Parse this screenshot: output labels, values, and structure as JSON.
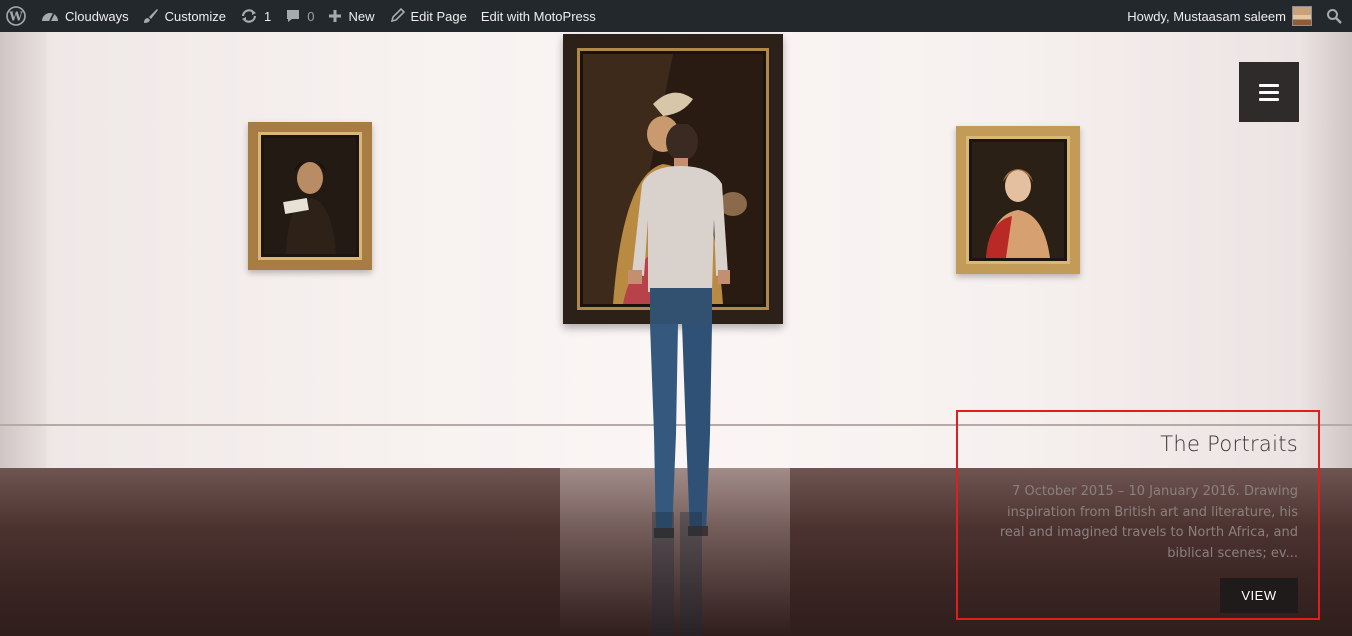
{
  "admin_bar": {
    "site_name": "Cloudways",
    "customize": "Customize",
    "updates_count": "1",
    "comments_count": "0",
    "new": "New",
    "edit_page": "Edit Page",
    "edit_with": "Edit with MotoPress",
    "howdy": "Howdy, Mustaasam saleem",
    "icons": [
      "wordpress-icon",
      "dashboard-icon",
      "brush-icon",
      "updates-icon",
      "comment-icon",
      "plus-icon",
      "pencil-icon",
      "search-icon"
    ]
  },
  "hero": {
    "menu_icon": "hamburger-icon",
    "slide": {
      "title": "The Portraits",
      "description": "7 October 2015 – 10 January 2016. Drawing inspiration from British art and literature, his real and imagined travels to North Africa, and biblical scenes; ev...",
      "button": "VIEW"
    },
    "highlight_color": "#e11d1d"
  }
}
